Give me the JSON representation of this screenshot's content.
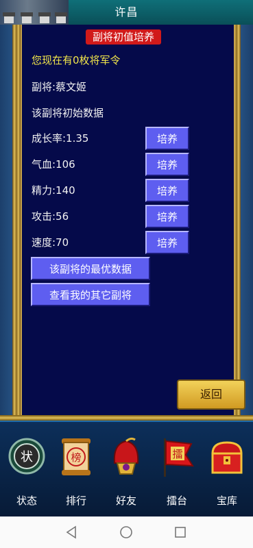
{
  "window": {
    "city_title": "许昌"
  },
  "panel": {
    "title": "副将初值培养",
    "tokens_line": "您现在有0枚将军令",
    "general_line": "副将:蔡文姬",
    "initial_data_line": "该副将初始数据",
    "stats": [
      {
        "label": "成长率:1.35",
        "button": "培养"
      },
      {
        "label": "气血:106",
        "button": "培养"
      },
      {
        "label": "精力:140",
        "button": "培养"
      },
      {
        "label": "攻击:56",
        "button": "培养"
      },
      {
        "label": "速度:70",
        "button": "培养"
      }
    ],
    "best_data_button": "该副将的最优数据",
    "view_others_button": "查看我的其它副将",
    "back_button": "返回"
  },
  "bottom_nav": [
    {
      "label": "状态",
      "icon": "status-medal-icon",
      "glyph": "状"
    },
    {
      "label": "排行",
      "icon": "ranking-scroll-icon",
      "glyph": "榜"
    },
    {
      "label": "好友",
      "icon": "friends-helmet-icon"
    },
    {
      "label": "擂台",
      "icon": "arena-flag-icon",
      "glyph": "擂"
    },
    {
      "label": "宝库",
      "icon": "treasure-chest-icon"
    }
  ],
  "colors": {
    "title_red": "#d11a1a",
    "button_blue": "#5e5ef0",
    "gold": "#e2c05a",
    "panel_bg": "#050a4a"
  }
}
